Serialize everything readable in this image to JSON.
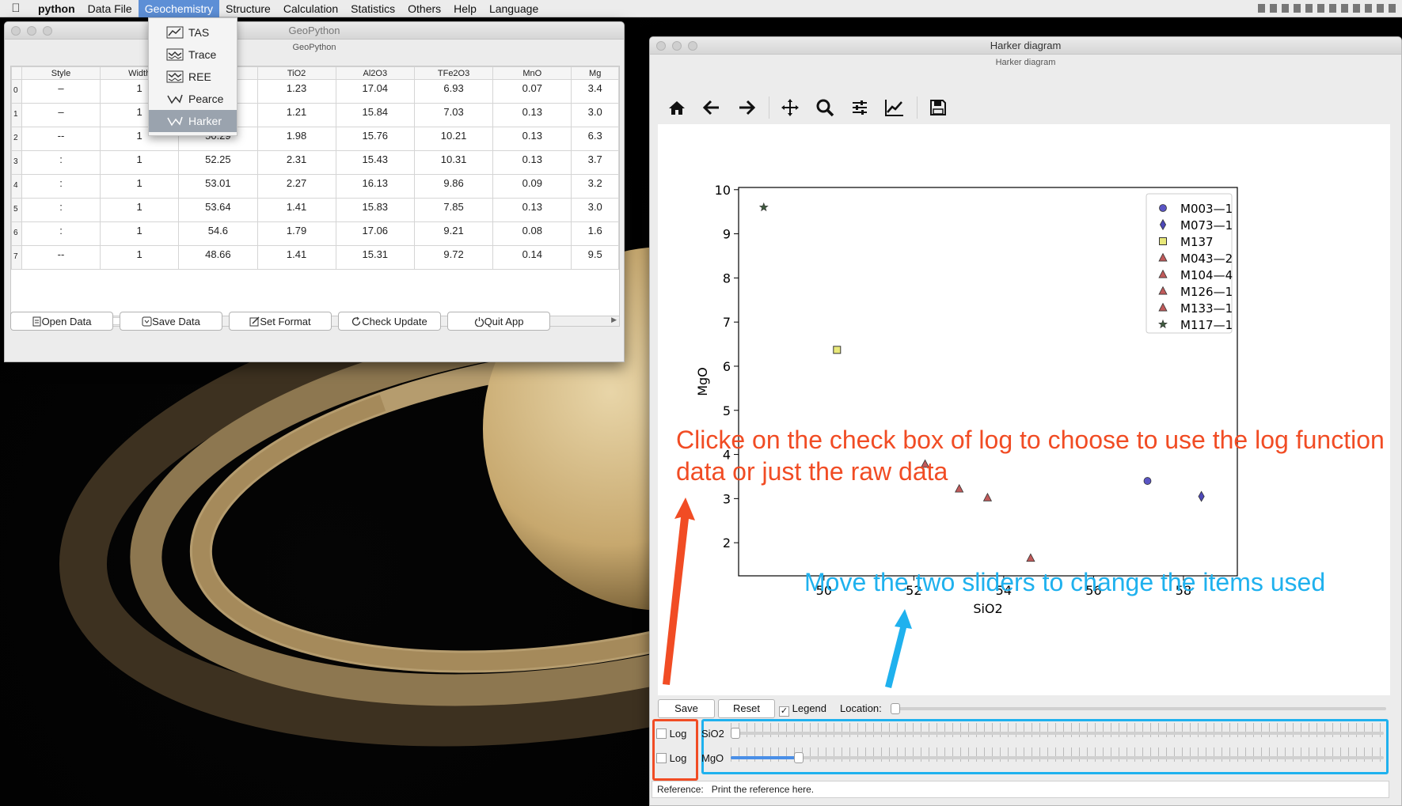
{
  "menubar": {
    "app_name": "python",
    "items": [
      "Data File",
      "Geochemistry",
      "Structure",
      "Calculation",
      "Statistics",
      "Others",
      "Help",
      "Language"
    ],
    "active_index": 1
  },
  "geochem_menu": {
    "items": [
      {
        "label": "TAS",
        "icon": "tas-line-icon"
      },
      {
        "label": "Trace",
        "icon": "trace-spider-icon"
      },
      {
        "label": "REE",
        "icon": "ree-spider-icon"
      },
      {
        "label": "Pearce",
        "icon": "pearce-icon"
      },
      {
        "label": "Harker",
        "icon": "harker-icon"
      }
    ],
    "selected_index": 4
  },
  "geo_window": {
    "title": "GeoPython",
    "subtitle": "GeoPython",
    "table": {
      "columns": [
        "Style",
        "Width",
        "",
        "TiO2",
        "Al2O3",
        "TFe2O3",
        "MnO",
        "Mg"
      ],
      "rows": [
        {
          "idx": "0",
          "cells": [
            "–",
            "1",
            "",
            "1.23",
            "17.04",
            "6.93",
            "0.07",
            "3.4"
          ]
        },
        {
          "idx": "1",
          "cells": [
            "–",
            "1",
            "",
            "1.21",
            "15.84",
            "7.03",
            "0.13",
            "3.0"
          ]
        },
        {
          "idx": "2",
          "cells": [
            "--",
            "1",
            "50.29",
            "1.98",
            "15.76",
            "10.21",
            "0.13",
            "6.3"
          ]
        },
        {
          "idx": "3",
          "cells": [
            ":",
            "1",
            "52.25",
            "2.31",
            "15.43",
            "10.31",
            "0.13",
            "3.7"
          ]
        },
        {
          "idx": "4",
          "cells": [
            ":",
            "1",
            "53.01",
            "2.27",
            "16.13",
            "9.86",
            "0.09",
            "3.2"
          ]
        },
        {
          "idx": "5",
          "cells": [
            ":",
            "1",
            "53.64",
            "1.41",
            "15.83",
            "7.85",
            "0.13",
            "3.0"
          ]
        },
        {
          "idx": "6",
          "cells": [
            ":",
            "1",
            "54.6",
            "1.79",
            "17.06",
            "9.21",
            "0.08",
            "1.6"
          ]
        },
        {
          "idx": "7",
          "cells": [
            "--",
            "1",
            "48.66",
            "1.41",
            "15.31",
            "9.72",
            "0.14",
            "9.5"
          ]
        }
      ]
    },
    "buttons": {
      "open": "Open Data",
      "save": "Save Data",
      "format": "Set Format",
      "update": "Check Update",
      "quit": "Quit App"
    }
  },
  "harker_window": {
    "title": "Harker diagram",
    "subtitle": "Harker diagram",
    "toolbar_icons": [
      "home-icon",
      "back-arrow-icon",
      "forward-arrow-icon",
      "pan-icon",
      "zoom-icon",
      "configure-subplots-icon",
      "edit-axes-icon",
      "save-figure-icon"
    ],
    "controls": {
      "save_label": "Save",
      "reset_label": "Reset",
      "legend_label": "Legend",
      "legend_checked": true,
      "location_label": "Location:",
      "log_label_1": "Log",
      "log_label_2": "Log",
      "slider_x_label": "SiO2",
      "slider_y_label": "MgO",
      "reference_label": "Reference:",
      "reference_text": "Print the reference here."
    }
  },
  "chart_data": {
    "type": "scatter",
    "xlabel": "SiO2",
    "ylabel": "MgO",
    "xlim": [
      48.1,
      59.2
    ],
    "ylim": [
      1.25,
      10.05
    ],
    "xticks": [
      50,
      52,
      54,
      56,
      58
    ],
    "yticks": [
      2,
      3,
      4,
      5,
      6,
      7,
      8,
      9,
      10
    ],
    "legend_position": "upper right",
    "series": [
      {
        "name": "M003—1",
        "marker": "circle",
        "color": "#5a55c4",
        "points": [
          [
            57.2,
            3.4
          ]
        ]
      },
      {
        "name": "M073—1",
        "marker": "diamond",
        "color": "#4d48b8",
        "points": [
          [
            58.4,
            3.05
          ]
        ]
      },
      {
        "name": "M137",
        "marker": "square",
        "color": "#e8e87a",
        "points": [
          [
            50.29,
            6.37
          ]
        ]
      },
      {
        "name": "M043—2",
        "marker": "triangle",
        "color": "#c05a5a",
        "points": [
          [
            52.25,
            3.78
          ]
        ]
      },
      {
        "name": "M104—4",
        "marker": "triangle",
        "color": "#c05a5a",
        "points": [
          [
            53.01,
            3.22
          ]
        ]
      },
      {
        "name": "M126—1",
        "marker": "triangle",
        "color": "#c05a5a",
        "points": [
          [
            53.64,
            3.02
          ]
        ]
      },
      {
        "name": "M133—1",
        "marker": "triangle",
        "color": "#c05a5a",
        "points": [
          [
            54.6,
            1.65
          ]
        ]
      },
      {
        "name": "M117—1",
        "marker": "star",
        "color": "#3e5a3e",
        "points": [
          [
            48.66,
            9.6
          ]
        ]
      }
    ]
  },
  "annotations": {
    "log_note": "Clicke on the check box of log to choose to use the log function data or just the raw data",
    "slider_note": "Move the two sliders to change the items used",
    "log_color": "#f14c24",
    "slider_color": "#1fb1ee"
  }
}
